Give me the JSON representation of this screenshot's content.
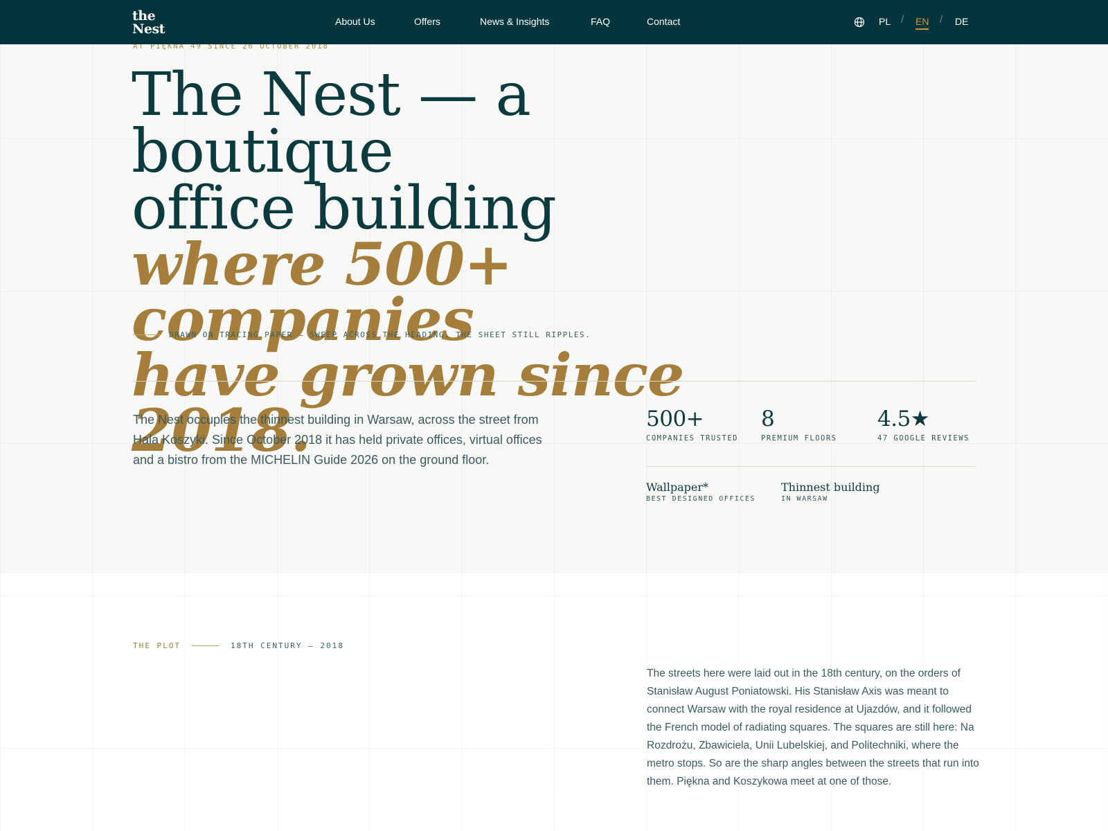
{
  "header": {
    "logo_line1": "the",
    "logo_line2": "Nest",
    "nav": [
      "About Us",
      "Offers",
      "News & Insights",
      "FAQ",
      "Contact"
    ],
    "languages": [
      "PL",
      "EN",
      "DE"
    ],
    "active_language": "EN",
    "language_separator": "/",
    "globe_icon": "globe-icon"
  },
  "hero": {
    "eyebrow": "AT PIĘKNA 49 SINCE 26 OCTOBER 2018",
    "headline_line1": "The Nest — a boutique",
    "headline_line2": "office building",
    "headline_line3": "where 500+ companies",
    "headline_line4": "have grown since 2018.",
    "hint": "DRAWN ON TRACING PAPER — SWEEP ACROSS THE HEADING. THE SHEET STILL RIPPLES.",
    "intro": "The Nest occupies the thinnest building in Warsaw, across the street from Hala Koszyki. Since October 2018 it has held private offices, virtual offices and a bistro from the MICHELIN Guide 2026 on the ground floor."
  },
  "stats": [
    {
      "value": "500+",
      "label": "COMPANIES TRUSTED"
    },
    {
      "value": "8",
      "label": "PREMIUM FLOORS"
    },
    {
      "value": "4.5★",
      "label": "47 GOOGLE REVIEWS"
    }
  ],
  "awards": [
    {
      "title": "Wallpaper*",
      "subtitle": "BEST DESIGNED OFFICES"
    },
    {
      "title": "Thinnest building",
      "subtitle": "IN WARSAW"
    }
  ],
  "plot": {
    "label": "THE PLOT",
    "range": "18TH CENTURY — 2018",
    "body": "The streets here were laid out in the 18th century, on the orders of Stanisław August Poniatowski. His Stanisław Axis was meant to connect Warsaw with the royal residence at Ujazdów, and it followed the French model of radiating squares. The squares are still here: Na Rozdrożu, Zbawiciela, Unii Lubelskiej, and Politechniki, where the metro stops. So are the sharp angles between the streets that run into them. Piękna and Koszykowa meet at one of those."
  },
  "colors": {
    "header_bg": "#05353c",
    "primary": "#0b3a3f",
    "accent": "#a57e3c",
    "page_bg": "#f8f8f6"
  }
}
